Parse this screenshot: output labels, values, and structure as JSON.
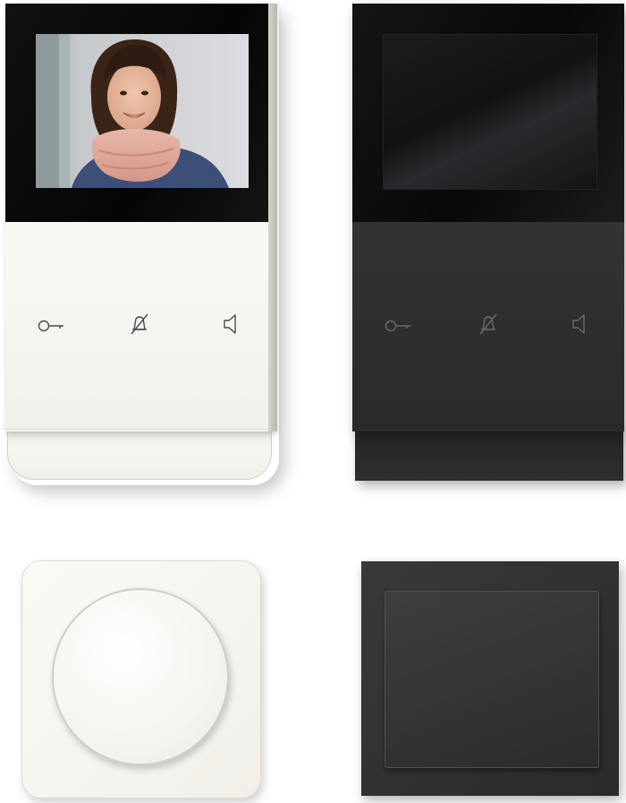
{
  "products": {
    "white_intercom": {
      "icons": [
        "door-key-icon",
        "bell-muted-icon",
        "speaker-icon"
      ],
      "color": "#f7f6f2"
    },
    "black_intercom": {
      "icons": [
        "door-key-icon",
        "bell-muted-icon",
        "speaker-icon"
      ],
      "color": "#2b2b2d"
    },
    "white_switch": {
      "color": "#f6f4ef"
    },
    "black_switch": {
      "color": "#333335"
    }
  }
}
